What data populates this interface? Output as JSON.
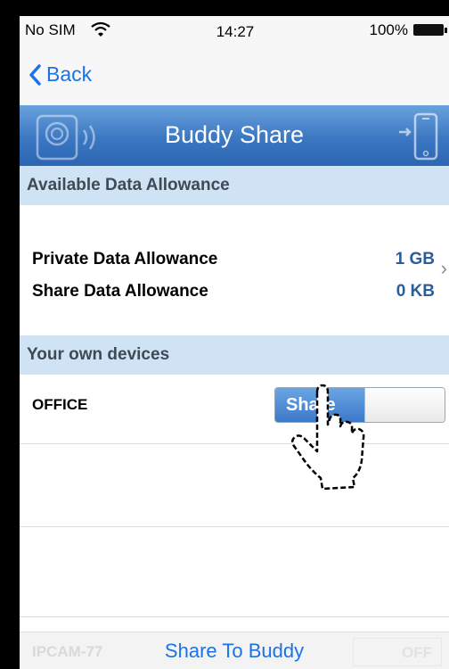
{
  "status_bar": {
    "carrier": "No SIM",
    "time": "14:27",
    "battery": "100%"
  },
  "nav": {
    "back_label": "Back"
  },
  "banner": {
    "title": "Buddy Share"
  },
  "sections": {
    "allowance_header": "Available Data Allowance",
    "devices_header": "Your own devices"
  },
  "allowance": {
    "private_label": "Private Data Allowance",
    "private_value": "1 GB",
    "share_label": "Share Data Allowance",
    "share_value": "0 KB"
  },
  "devices": [
    {
      "name": "OFFICE",
      "toggle_label": "Share",
      "state": "on"
    }
  ],
  "bottom_bar": {
    "action_label": "Share To Buddy",
    "ghost_device": "IPCAM-77",
    "ghost_toggle": "OFF"
  },
  "colors": {
    "accent": "#1a73e8",
    "banner": "#3b77c2",
    "section_bg": "#cfe3f5",
    "value_text": "#2a5d9a"
  },
  "icons": [
    "wifi-icon",
    "battery-icon",
    "back-chevron-icon",
    "camera-icon",
    "phone-share-icon",
    "chevron-right-icon",
    "pointer-hand-icon"
  ]
}
